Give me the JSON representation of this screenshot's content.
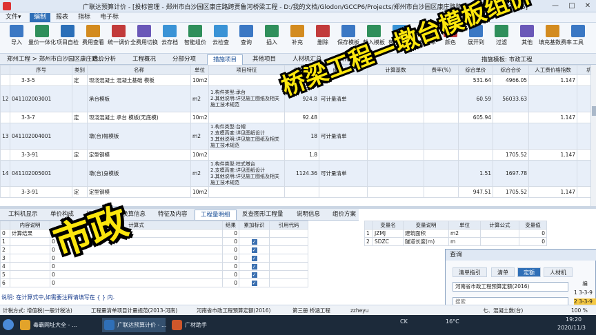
{
  "titlebar": {
    "title": "广联达预算计价 - [投标管理 - 郑州市白沙园区康庄路跨贾鲁河桥梁工程 - D:/我的文档/Glodon/GCCP6/Projects/郑州市白沙园区康庄路跨贾鲁河桥梁工程.GBQ6]",
    "minimize": "—",
    "maximize": "□",
    "close": "✕"
  },
  "menubar": {
    "items": [
      "文件▾",
      "编制",
      "报表",
      "指标",
      "电子标"
    ],
    "active_index": 1
  },
  "toolbar": {
    "items": [
      {
        "label": "导入",
        "icon": "import-icon",
        "color": "#3b78c4"
      },
      {
        "label": "量价一体化",
        "icon": "integration-icon",
        "color": "#2f8f5b"
      },
      {
        "label": "项目自检",
        "icon": "self-check-icon",
        "color": "#2b6fb8"
      },
      {
        "label": "费用查看",
        "icon": "fee-view-icon",
        "color": "#d38b1f"
      },
      {
        "label": "统一调价",
        "icon": "price-adjust-icon",
        "color": "#c23b3b"
      },
      {
        "label": "全费用切换",
        "icon": "full-cost-switch-icon",
        "color": "#6a58b8"
      },
      {
        "label": "云存档",
        "icon": "cloud-save-icon",
        "color": "#3a93d6"
      },
      {
        "label": "智能组价",
        "icon": "smart-pricing-icon",
        "color": "#2f8f5b"
      },
      {
        "label": "云检查",
        "icon": "cloud-check-icon",
        "color": "#3a93d6"
      },
      {
        "label": "查询",
        "icon": "query-icon",
        "color": "#3b78c4"
      },
      {
        "label": "插入",
        "icon": "insert-icon",
        "color": "#2f8f5b"
      },
      {
        "label": "补充",
        "icon": "supplement-icon",
        "color": "#d38b1f"
      },
      {
        "label": "删除",
        "icon": "delete-icon",
        "color": "#c23b3b"
      },
      {
        "label": "保存模板",
        "icon": "save-template-icon",
        "color": "#3b78c4"
      },
      {
        "label": "载入模板",
        "icon": "load-template-icon",
        "color": "#2f8f5b"
      },
      {
        "label": "替换模板",
        "icon": "replace-template-icon",
        "color": "#3a93d6"
      },
      {
        "label": "锁定清单",
        "icon": "lock-icon",
        "color": "#c9a227"
      },
      {
        "label": "颜色",
        "icon": "color-icon",
        "color": "#c23b3b"
      },
      {
        "label": "展开到",
        "icon": "expand-icon",
        "color": "#3b78c4"
      },
      {
        "label": "过滤",
        "icon": "filter-icon",
        "color": "#2f8f5b"
      },
      {
        "label": "其他",
        "icon": "other-icon",
        "color": "#6a58b8"
      },
      {
        "label": "填充基数费率",
        "icon": "fill-rate-icon",
        "color": "#d38b1f"
      },
      {
        "label": "工具",
        "icon": "tools-icon",
        "color": "#3b78c4"
      }
    ]
  },
  "tabbar": {
    "breadcrumb": "郑州工程 > 郑州市白沙园区康庄路...",
    "tabs": [
      "造价分析",
      "工程概况",
      "分部分项",
      "措施项目",
      "其他项目",
      "人材机汇总",
      "费用汇总"
    ],
    "active_index": 3,
    "mould_label": "措施模板: 市政工程"
  },
  "grid": {
    "headers": [
      "",
      "序号",
      "类别",
      "名称",
      "单位",
      "项目特征",
      "工程量",
      "组价方式",
      "计算基数",
      "费率(%)",
      "综合单价",
      "综合合价",
      "人工费价格指数",
      "机械费"
    ],
    "rows": [
      {
        "kind": "sub",
        "no": "",
        "code": "3-3-5",
        "type": "定",
        "name": "现浇混凝土 混凝土基础 模板",
        "unit": "10m2",
        "feature": "",
        "qty": "9.341",
        "method": "",
        "base": "",
        "rate": "",
        "price": "531.64",
        "total": "4966.05",
        "labor": "1.147"
      },
      {
        "kind": "qd",
        "no": "12",
        "code": "041102003001",
        "type": "",
        "name": "承台模板",
        "unit": "m2",
        "feature": "1.构件类型:承台\n2.其他说明:详见施工图纸及相关施工技术规范",
        "qty": "924.8",
        "method": "可计量清单",
        "base": "",
        "rate": "",
        "price": "60.59",
        "total": "56033.63",
        "labor": ""
      },
      {
        "kind": "sub",
        "no": "",
        "code": "3-3-7",
        "type": "定",
        "name": "现浇混凝土 承台 模板(无底模)",
        "unit": "10m2",
        "feature": "",
        "qty": "92.48",
        "method": "",
        "base": "",
        "rate": "",
        "price": "605.94",
        "total": "",
        "labor": "1.147"
      },
      {
        "kind": "qd",
        "no": "13",
        "code": "041102004001",
        "type": "",
        "name": "墩(台)帽模板",
        "unit": "m2",
        "feature": "1.构件类型:台帽\n2.支模高度:详见图纸设计\n3.其他说明:详见施工图纸及相关施工技术规范",
        "qty": "18",
        "method": "可计量清单",
        "base": "",
        "rate": "",
        "price": "",
        "total": "",
        "labor": ""
      },
      {
        "kind": "sub",
        "no": "",
        "code": "3-3-91",
        "type": "定",
        "name": "定型钢模",
        "unit": "10m2",
        "feature": "",
        "qty": "1.8",
        "method": "",
        "base": "",
        "rate": "",
        "price": "",
        "total": "1705.52",
        "labor": "1.147"
      },
      {
        "kind": "qd",
        "no": "14",
        "code": "041102005001",
        "type": "",
        "name": "墩(台)身模板",
        "unit": "m2",
        "feature": "1.构件类型:柱式墩台\n2.支模高度:详见图纸设计\n3.其他说明:详见施工图纸及相关施工技术规范",
        "qty": "1124.36",
        "method": "可计量清单",
        "base": "",
        "rate": "",
        "price": "1.51",
        "total": "1697.78",
        "labor": ""
      },
      {
        "kind": "sub",
        "no": "",
        "code": "3-3-91",
        "type": "定",
        "name": "定型钢模",
        "unit": "10m2",
        "feature": "",
        "qty": "",
        "method": "",
        "base": "",
        "rate": "",
        "price": "947.51",
        "total": "1705.52",
        "labor": "1.147"
      }
    ]
  },
  "bottom_tabs": {
    "tabs": [
      "工料机显示",
      "单价构成",
      "标准换算",
      "换算信息",
      "特征及内容",
      "工程量明细",
      "反查图形工程量",
      "说明信息",
      "组价方案"
    ],
    "active_index": 5
  },
  "detail_table": {
    "headers": [
      "",
      "内容说明",
      "计算式",
      "结果",
      "累加标识",
      "引用代码"
    ],
    "rows": [
      {
        "idx": "0",
        "content": "计算结果",
        "formula": "",
        "result": "0",
        "flag": false
      },
      {
        "idx": "1",
        "content": "",
        "formula": "0",
        "result": "0",
        "flag": true
      },
      {
        "idx": "2",
        "content": "",
        "formula": "0",
        "result": "0",
        "flag": true
      },
      {
        "idx": "3",
        "content": "",
        "formula": "0",
        "result": "0",
        "flag": true
      },
      {
        "idx": "4",
        "content": "",
        "formula": "0",
        "result": "0",
        "flag": true
      },
      {
        "idx": "5",
        "content": "",
        "formula": "0",
        "result": "0",
        "flag": true
      },
      {
        "idx": "6",
        "content": "",
        "formula": "0",
        "result": "0",
        "flag": true
      }
    ]
  },
  "variable_table": {
    "headers": [
      "",
      "变量名",
      "变量说明",
      "单位",
      "计算公式",
      "变量值"
    ],
    "rows": [
      {
        "idx": "1",
        "name": "JZMJ",
        "desc": "建筑面积",
        "unit": "m2",
        "formula": "",
        "value": "0"
      },
      {
        "idx": "2",
        "name": "SDZC",
        "desc": "隧道长度(m)",
        "unit": "m",
        "formula": "",
        "value": "0"
      }
    ]
  },
  "query_panel": {
    "title": "查询",
    "tabs": [
      "清单指引",
      "清单",
      "定额",
      "人材机"
    ],
    "active_index": 2,
    "quota_select": "河南省市政工程预算定额(2016)",
    "search_placeholder": "搜索",
    "side_header": "编",
    "side_rows": [
      "3-3-9",
      "3-3-9"
    ],
    "side_idx": [
      "1",
      "2"
    ]
  },
  "hint": "说明: 在计算式中,如需要注释请填写在 { } 内.",
  "statusbar": {
    "items": [
      "计税方式: 增值税(一般计税法)",
      "工程量清单项目计量规范(2013-河南)",
      "河南省市政工程预算定额(2016)",
      "第三册 桥涵工程",
      "zzheyu"
    ],
    "ime": "七、混凝土敷(台)",
    "zoom": "100 %"
  },
  "taskbar": {
    "items": [
      "毒霸网址大全 - ...",
      "广联达预算计价 - ...",
      "广材助手"
    ],
    "tray_weather": "16°C",
    "tray_ck": "CK",
    "time": "19:20",
    "date": "2020/11/3"
  },
  "overlay": {
    "line1": "桥梁工程—墩台模板组价",
    "line2": "市政"
  }
}
